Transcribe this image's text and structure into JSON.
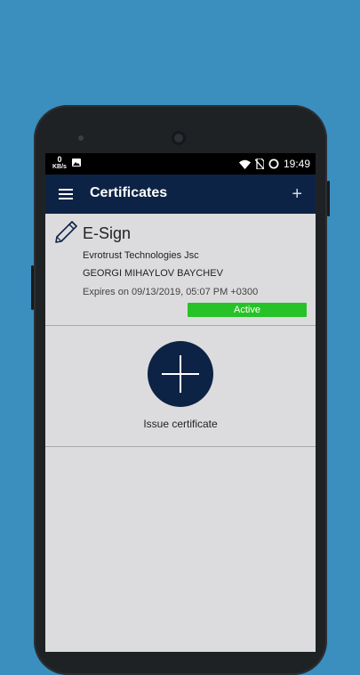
{
  "statusbar": {
    "net_speed": "0",
    "net_unit": "KB/s",
    "time": "19:49"
  },
  "appbar": {
    "title": "Certificates"
  },
  "certificate": {
    "type": "E-Sign",
    "issuer": "Evrotrust Technologies Jsc",
    "holder": "GEORGI MIHAYLOV BAYCHEV",
    "expiry": "Expires on 09/13/2019, 05:07 PM +0300",
    "status": "Active"
  },
  "issue": {
    "label": "Issue certificate"
  },
  "colors": {
    "background": "#3a8fbf",
    "appbar": "#0d2345",
    "status_active": "#27c227",
    "screen": "#dcdcde"
  },
  "icons": [
    "menu-icon",
    "add-icon",
    "pen-icon",
    "plus-icon",
    "wifi-icon",
    "no-sim-icon",
    "circle-status-icon",
    "image-icon"
  ]
}
